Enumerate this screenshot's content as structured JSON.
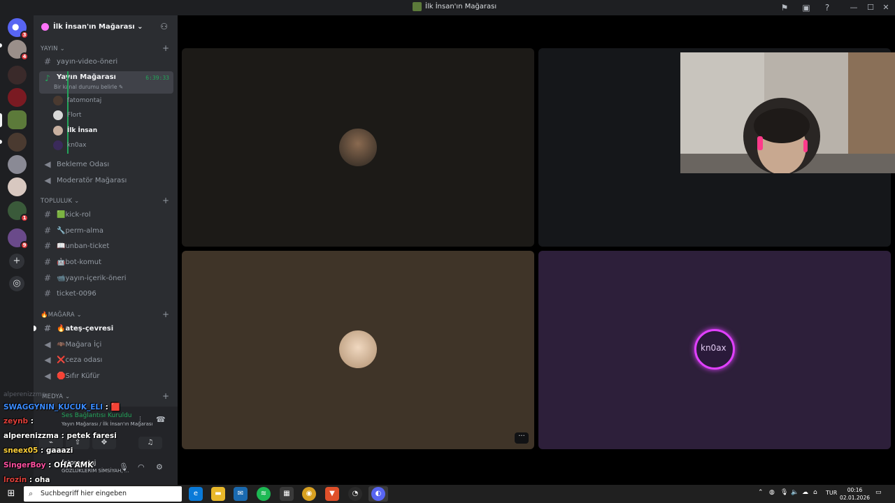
{
  "window": {
    "title": "İlk İnsan'ın Mağarası"
  },
  "guilds": {
    "badges": [
      "3",
      "4",
      "1",
      "9"
    ]
  },
  "server": {
    "name": "İlk İnsan'ın Mağarası ⌄"
  },
  "categories": {
    "yayin": "YAYIN ⌄",
    "topluluk": "TOPLULUK ⌄",
    "magara": "🔥MAĞARA ⌄",
    "medya": "Medya ⌄"
  },
  "channels": {
    "yayin_video_oneri": "yayın-video-öneri",
    "yayin_magarasi": "Yayın Mağarası",
    "yayin_status": "Bir kanal durumu belirle ✎",
    "yayin_timer": "6:39:33",
    "bekleme": "Bekleme Odası",
    "moderator": "Moderatör Mağarası",
    "kick_rol": "🟩kick-rol",
    "perm_alma": "🔧perm-alma",
    "unban_ticket": "📖unban-ticket",
    "bot_komut": "🤖bot-komut",
    "yayin_icerik": "📹yayın-içerik-öneri",
    "ticket": "ticket-0096",
    "ates": "🔥ateş-çevresi",
    "magara_ici": "🦇Mağara İçi",
    "ceza": "❌ceza odası",
    "sifir": "🛑Sıfır Küfür"
  },
  "voice_users": [
    "fatomontaj",
    "Flort",
    "İlk İnsan",
    "kn0ax"
  ],
  "voice_panel": {
    "status": "Ses Bağlantısı Kuruldu",
    "sub": "Yayın Mağarası / İlk İnsan'ın Mağarası",
    "user": "fatomontaj",
    "user_status": "GÖZLÜKLERİM SİMSİYAH, ..."
  },
  "chat": {
    "ghost": "alperenizzma",
    "lines": [
      {
        "user": "SWAGGYNIN_KUCUK_ELI",
        "msg": " : 🟥",
        "color": "#3a8bff"
      },
      {
        "user": "zeynb",
        "msg": " :",
        "color": "#e0403a"
      },
      {
        "user": "alperenizzma",
        "msg": " : petek faresi",
        "color": "#ffffff"
      },
      {
        "user": "sneex05",
        "msg": " : gaaazi",
        "color": "#ffd23a"
      },
      {
        "user": "SingerBoy",
        "msg": " : OHA AMK",
        "color": "#ff4fa0"
      },
      {
        "user": "lrozin",
        "msg": " : oha",
        "color": "#e0403a"
      }
    ],
    "bottom_ghost": "sım mıolur mesaı"
  },
  "stage": {
    "tile_name_kn0ax": "kn0ax",
    "more": "···"
  },
  "taskbar": {
    "search_placeholder": "Suchbegriff hier eingeben",
    "lang": "TUR",
    "time": "00:16",
    "date": "02.01.2026"
  },
  "colors": {
    "accent_green": "#23a55a",
    "tile_dark": "#1c1a17",
    "tile_dark2": "#15171a",
    "tile_brown": "#3f3428",
    "tile_purple": "#2d1f3a"
  }
}
